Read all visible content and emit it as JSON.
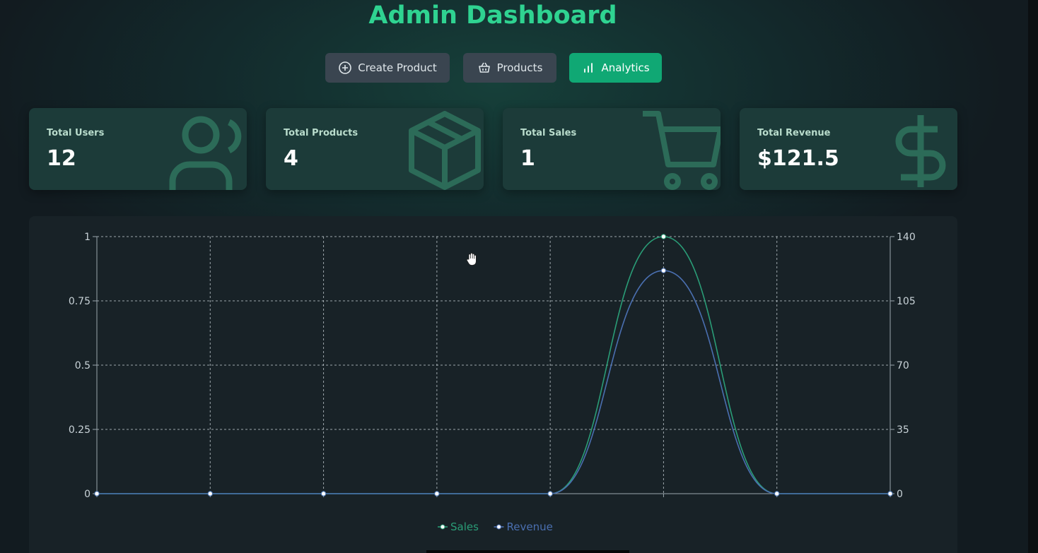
{
  "header": {
    "title": "Admin Dashboard"
  },
  "tabs": [
    {
      "label": "Create Product",
      "icon": "plus-circle-icon"
    },
    {
      "label": "Products",
      "icon": "basket-icon"
    },
    {
      "label": "Analytics",
      "icon": "bar-chart-icon",
      "active": true
    }
  ],
  "stats": [
    {
      "label": "Total Users",
      "value": "12",
      "icon": "users-icon"
    },
    {
      "label": "Total Products",
      "value": "4",
      "icon": "package-icon"
    },
    {
      "label": "Total Sales",
      "value": "1",
      "icon": "shopping-cart-icon"
    },
    {
      "label": "Total Revenue",
      "value": "$121.5",
      "icon": "dollar-sign-icon"
    }
  ],
  "colors": {
    "accent": "#10a874",
    "title": "#2fd391",
    "sales": "#2a9d77",
    "revenue": "#4a6fb0"
  },
  "chart_data": {
    "type": "line",
    "x": [
      "",
      "",
      "",
      "",
      "",
      "",
      "",
      ""
    ],
    "series": [
      {
        "name": "Sales",
        "axis": "left",
        "values": [
          0,
          0,
          0,
          0,
          0,
          1,
          0,
          0
        ]
      },
      {
        "name": "Revenue",
        "axis": "right",
        "values": [
          0,
          0,
          0,
          0,
          0,
          121.5,
          0,
          0
        ]
      }
    ],
    "y_left": {
      "ticks": [
        0,
        0.25,
        0.5,
        0.75,
        1
      ],
      "range": [
        0,
        1
      ]
    },
    "y_right": {
      "ticks": [
        0,
        35,
        70,
        105,
        140
      ],
      "range": [
        0,
        140
      ]
    },
    "grid": true,
    "legend_position": "bottom"
  }
}
